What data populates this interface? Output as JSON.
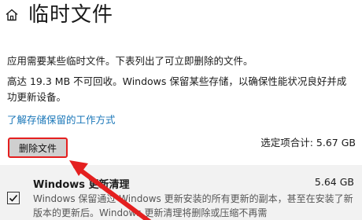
{
  "header": {
    "home_icon": "home-icon",
    "title": "临时文件"
  },
  "main": {
    "intro": "应用需要某些临时文件。下表列出了可立即删除的文件。",
    "storage_note": "高达 19.3 MB 不可回收。Windows 保留某些存储，以确保性能状况良好并成功更新设备。",
    "learn_link": "了解存储保留的工作方式",
    "delete_button": "删除文件",
    "selected_total": "选定项合计: 5.67 GB"
  },
  "items": [
    {
      "title": "Windows 更新清理",
      "size": "5.64 GB",
      "checked": true,
      "description": "Windows 保留通过 Windows 更新安装的所有更新的副本，甚至在安装了新版本的更新后。Windows 更新清理将删除或压缩不再需"
    }
  ],
  "colors": {
    "accent_link": "#1976b8",
    "highlight": "#e41f1f",
    "button_bg": "#cfcfcf",
    "row_bg": "#f2f2f2"
  }
}
